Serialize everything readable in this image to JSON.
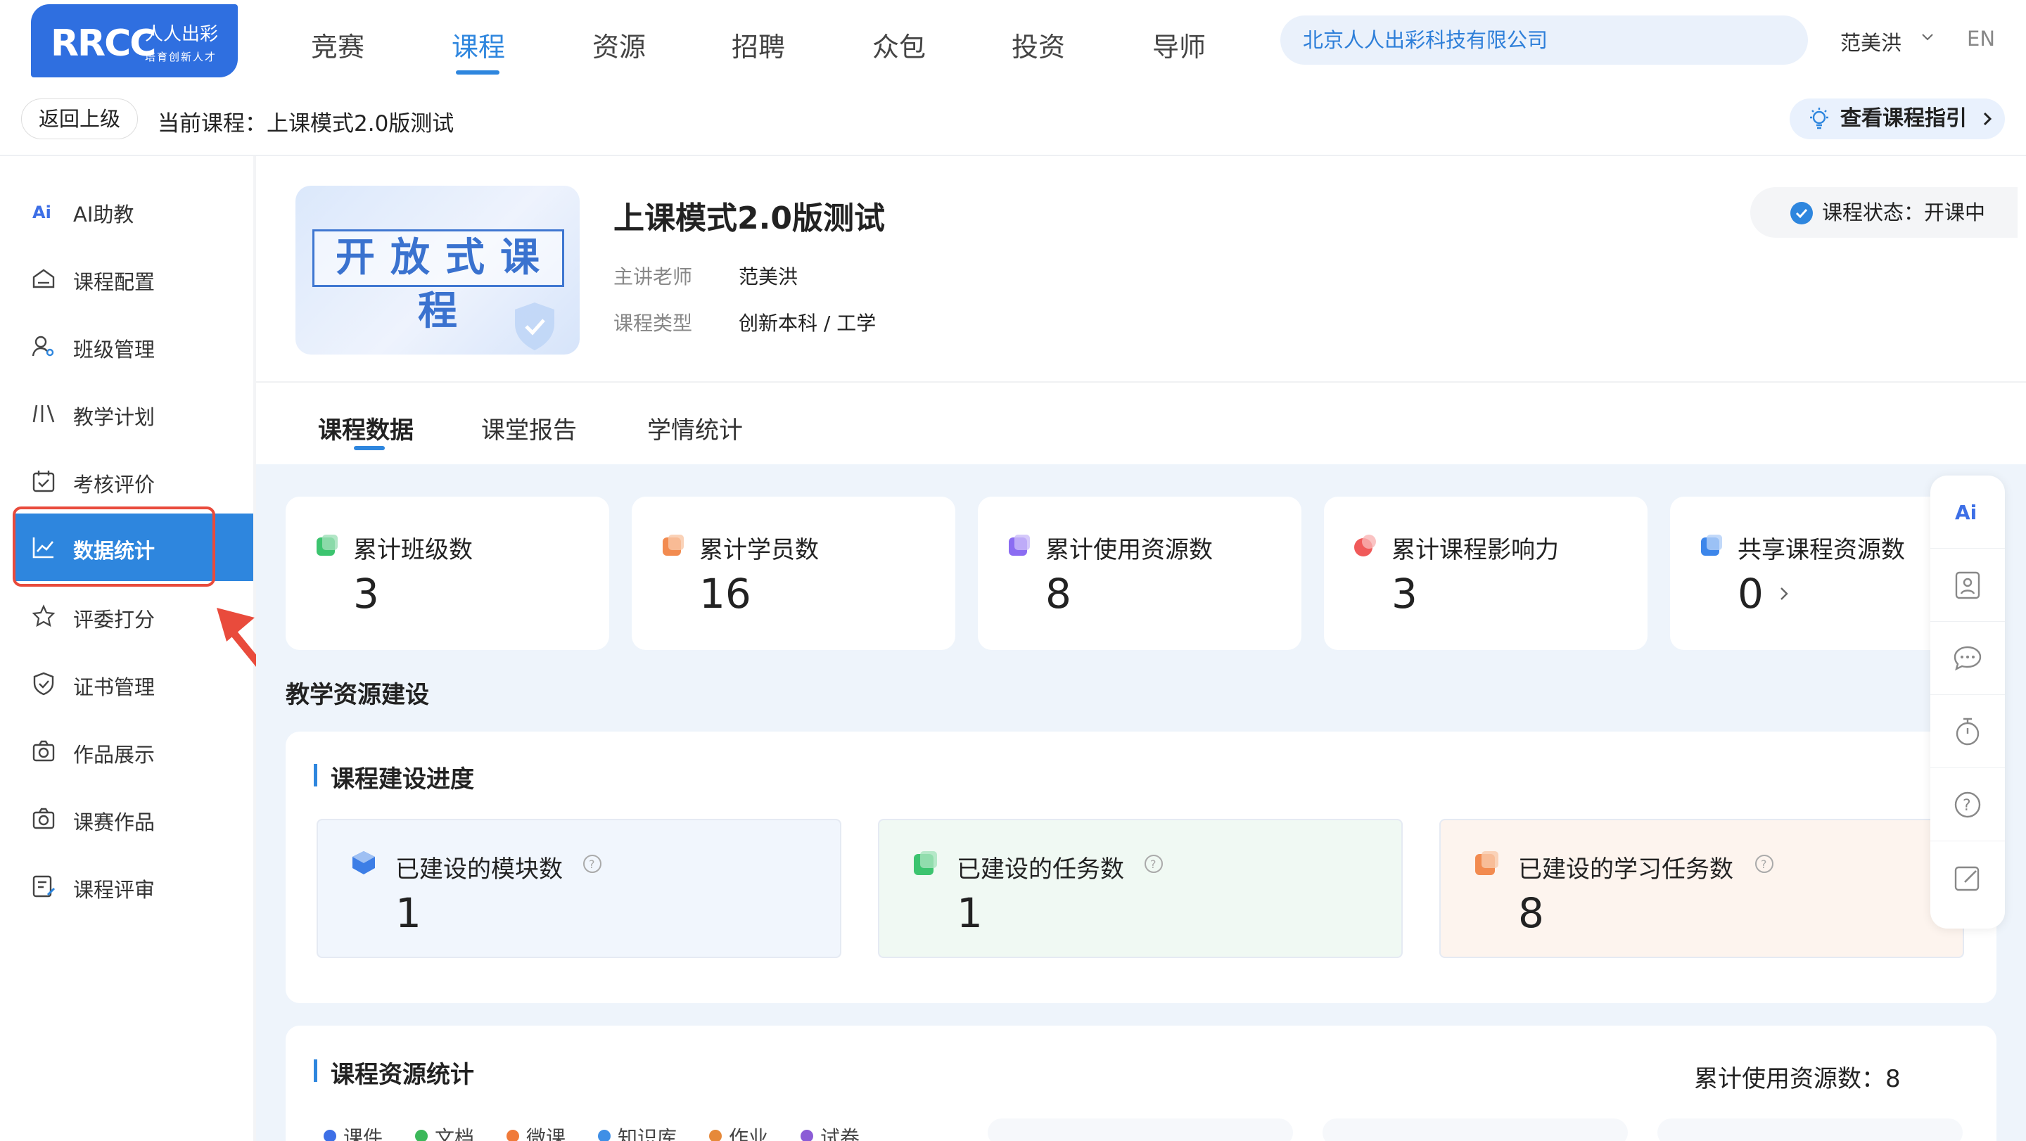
{
  "header": {
    "logo": {
      "text": "RRCC",
      "cn": "人人出彩",
      "slogan": "培育创新人才"
    },
    "nav": [
      "竞赛",
      "课程",
      "资源",
      "招聘",
      "众包",
      "投资",
      "导师"
    ],
    "active_nav": "课程",
    "company": "北京人人出彩科技有限公司",
    "user": "范美洪",
    "lang": "EN"
  },
  "subbar": {
    "back_label": "返回上级",
    "current_course_label": "当前课程：上课模式2.0版测试",
    "guide_label": "查看课程指引"
  },
  "sidebar": {
    "items": [
      {
        "label": "AI助教",
        "icon": "ai-icon"
      },
      {
        "label": "课程配置",
        "icon": "config-icon"
      },
      {
        "label": "班级管理",
        "icon": "class-icon"
      },
      {
        "label": "教学计划",
        "icon": "plan-icon"
      },
      {
        "label": "考核评价",
        "icon": "calendar-check-icon"
      },
      {
        "label": "数据统计",
        "icon": "chart-line-icon",
        "active": true
      },
      {
        "label": "评委打分",
        "icon": "star-icon"
      },
      {
        "label": "证书管理",
        "icon": "shield-check-icon"
      },
      {
        "label": "作品展示",
        "icon": "camera-icon"
      },
      {
        "label": "课赛作品",
        "icon": "camera-icon"
      },
      {
        "label": "课程评审",
        "icon": "review-icon"
      }
    ]
  },
  "course": {
    "cover_text": "开放式课程",
    "title": "上课模式2.0版测试",
    "teacher_label": "主讲老师",
    "teacher": "范美洪",
    "type_label": "课程类型",
    "type": "创新本科 / 工学",
    "status": "课程状态：开课中"
  },
  "tabs": [
    "课程数据",
    "课堂报告",
    "学情统计"
  ],
  "active_tab": "课程数据",
  "stats": [
    {
      "label": "累计班级数",
      "value": "3",
      "color": "#3cc46f"
    },
    {
      "label": "累计学员数",
      "value": "16",
      "color": "#f28b50"
    },
    {
      "label": "累计使用资源数",
      "value": "8",
      "color": "#8b6cf2"
    },
    {
      "label": "累计课程影响力",
      "value": "3",
      "color": "#f05a5a"
    },
    {
      "label": "共享课程资源数",
      "value": "0",
      "color": "#3d86ea"
    }
  ],
  "section_title": "教学资源建设",
  "progress_panel": {
    "title": "课程建设进度",
    "cards": [
      {
        "label": "已建设的模块数",
        "value": "1",
        "color": "#3d7ee6",
        "bg": "#f1f6fd"
      },
      {
        "label": "已建设的任务数",
        "value": "1",
        "color": "#3cc46f",
        "bg": "#f0f9f3"
      },
      {
        "label": "已建设的学习任务数",
        "value": "8",
        "color": "#f28b50",
        "bg": "#fdf4ee"
      }
    ]
  },
  "resource_panel": {
    "title": "课程资源统计",
    "total_label": "累计使用资源数：8",
    "legend": [
      {
        "label": "课件",
        "color": "#3d6fe6"
      },
      {
        "label": "文档",
        "color": "#3cb85a"
      },
      {
        "label": "微课",
        "color": "#f07a3a"
      },
      {
        "label": "知识库",
        "color": "#3f8fe6"
      },
      {
        "label": "作业",
        "color": "#e6893a"
      },
      {
        "label": "试卷",
        "color": "#8b5cd6"
      }
    ]
  },
  "right_toolbar": [
    "ai-icon",
    "user-card-icon",
    "chat-icon",
    "timer-icon",
    "help-icon",
    "edit-icon"
  ]
}
